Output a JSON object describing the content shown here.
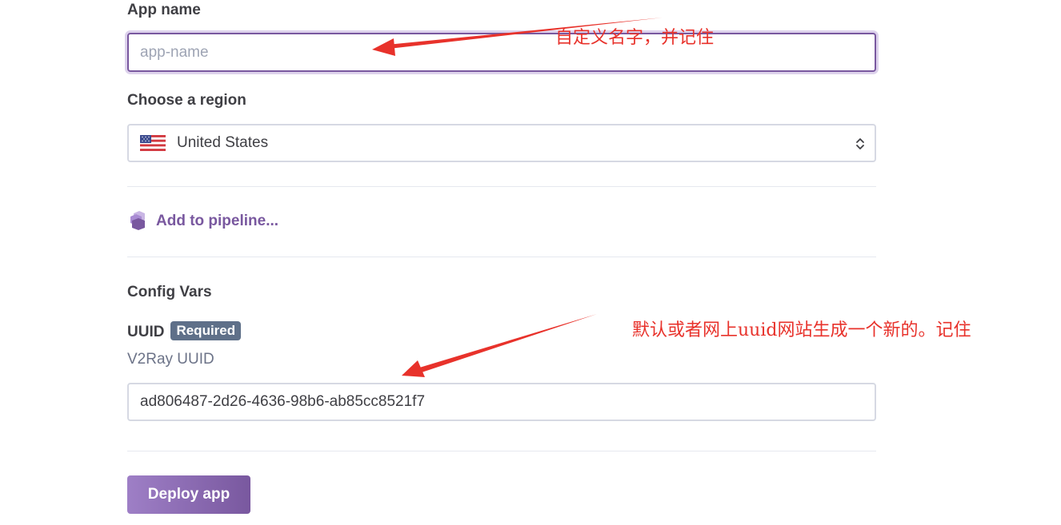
{
  "form": {
    "app_name": {
      "label": "App name",
      "value": "",
      "placeholder": "app-name"
    },
    "region": {
      "label": "Choose a region",
      "selected": "United States",
      "flag_icon": "us-flag-icon"
    },
    "pipeline": {
      "label": "Add to pipeline..."
    },
    "config_vars": {
      "title": "Config Vars",
      "uuid": {
        "label": "UUID",
        "badge": "Required",
        "description": "V2Ray UUID",
        "value": "ad806487-2d26-4636-98b6-ab85cc8521f7"
      }
    },
    "deploy_button": "Deploy app"
  },
  "annotations": {
    "app_name_note": "自定义名字，并记住",
    "uuid_note": "默认或者网上uuid网站生成一个新的。记住"
  },
  "colors": {
    "accent": "#79589f",
    "annotation": "#e8322b",
    "badge_bg": "#5f7089"
  }
}
